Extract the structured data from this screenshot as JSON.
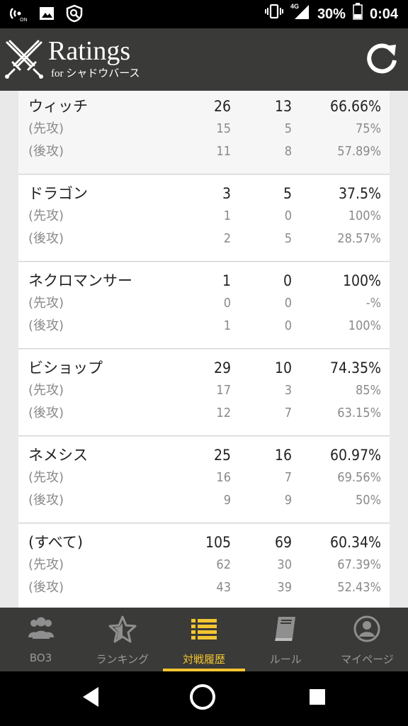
{
  "status_bar": {
    "battery": "30%",
    "time": "0:04",
    "network": "4G"
  },
  "app": {
    "title": "Ratings",
    "subtitle": "for シャドウバース"
  },
  "rows_labels": {
    "first": "(先攻)",
    "second": "(後攻)"
  },
  "stats": [
    {
      "name": "ウィッチ",
      "wins": "26",
      "losses": "13",
      "rate": "66.66%",
      "first": {
        "wins": "15",
        "losses": "5",
        "rate": "75%"
      },
      "second": {
        "wins": "11",
        "losses": "8",
        "rate": "57.89%"
      }
    },
    {
      "name": "ドラゴン",
      "wins": "3",
      "losses": "5",
      "rate": "37.5%",
      "first": {
        "wins": "1",
        "losses": "0",
        "rate": "100%"
      },
      "second": {
        "wins": "2",
        "losses": "5",
        "rate": "28.57%"
      }
    },
    {
      "name": "ネクロマンサー",
      "wins": "1",
      "losses": "0",
      "rate": "100%",
      "first": {
        "wins": "0",
        "losses": "0",
        "rate": "-%"
      },
      "second": {
        "wins": "1",
        "losses": "0",
        "rate": "100%"
      }
    },
    {
      "name": "ビショップ",
      "wins": "29",
      "losses": "10",
      "rate": "74.35%",
      "first": {
        "wins": "17",
        "losses": "3",
        "rate": "85%"
      },
      "second": {
        "wins": "12",
        "losses": "7",
        "rate": "63.15%"
      }
    },
    {
      "name": "ネメシス",
      "wins": "25",
      "losses": "16",
      "rate": "60.97%",
      "first": {
        "wins": "16",
        "losses": "7",
        "rate": "69.56%"
      },
      "second": {
        "wins": "9",
        "losses": "9",
        "rate": "50%"
      }
    },
    {
      "name": "(すべて)",
      "wins": "105",
      "losses": "69",
      "rate": "60.34%",
      "first": {
        "wins": "62",
        "losses": "30",
        "rate": "67.39%"
      },
      "second": {
        "wins": "43",
        "losses": "39",
        "rate": "52.43%"
      }
    }
  ],
  "nav": [
    {
      "label": "BO3",
      "icon": "people-icon",
      "active": false
    },
    {
      "label": "ランキング",
      "icon": "star-icon",
      "active": false
    },
    {
      "label": "対戦履歴",
      "icon": "list-icon",
      "active": true
    },
    {
      "label": "ルール",
      "icon": "book-icon",
      "active": false
    },
    {
      "label": "マイページ",
      "icon": "account-icon",
      "active": false
    }
  ],
  "colors": {
    "app_bar": "#3a3a38",
    "accent": "#f3c531",
    "card": "#ffffff",
    "background": "#e9e9e9"
  }
}
